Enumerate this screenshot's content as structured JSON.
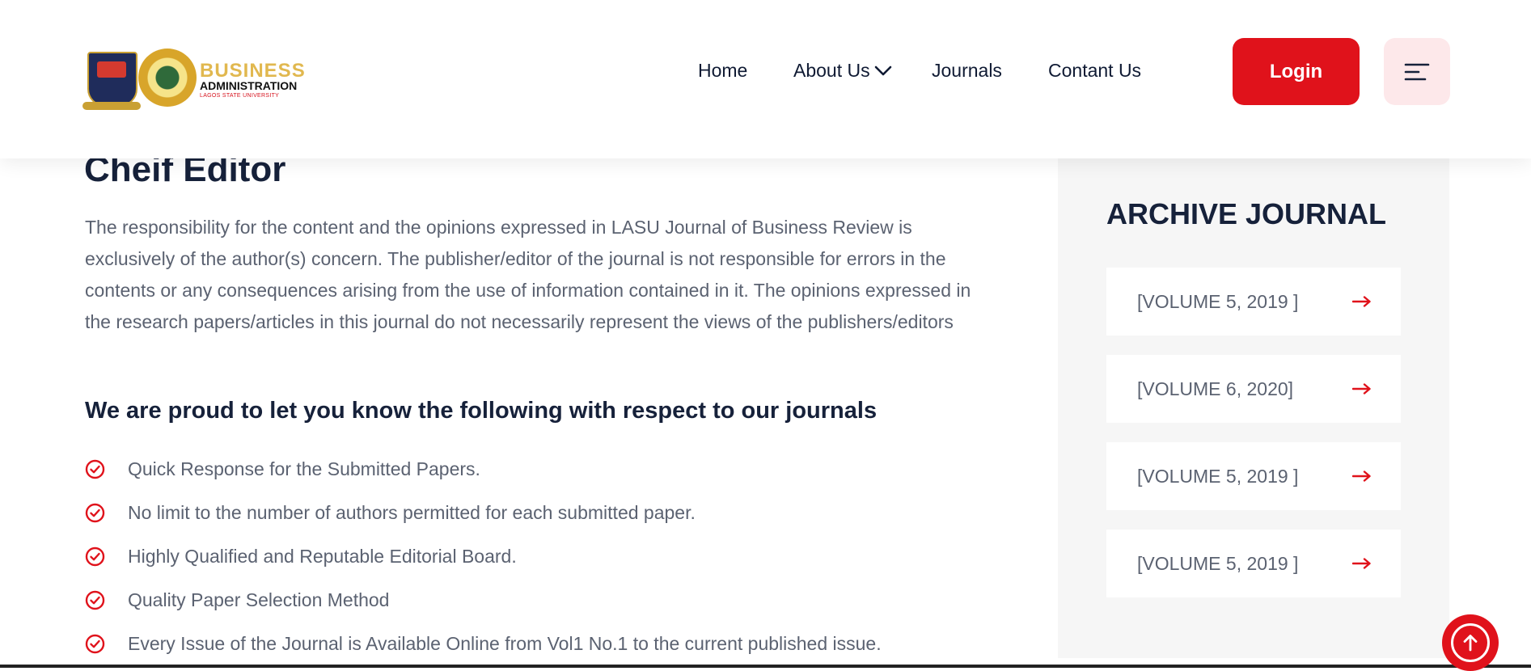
{
  "header": {
    "logo": {
      "line1": "BUSINESS",
      "line2": "ADMINISTRATION",
      "line3": "LAGOS STATE UNIVERSITY"
    },
    "nav": [
      {
        "label": "Home"
      },
      {
        "label": "About Us"
      },
      {
        "label": "Journals"
      },
      {
        "label": "Contant Us"
      }
    ],
    "login_label": "Login",
    "menu_icon": "hamburger-icon"
  },
  "main": {
    "heading": "Cheif Editor",
    "paragraph": "The responsibility for the content and the opinions expressed in LASU Journal of Business Review is exclusively of the author(s) concern. The publisher/editor of the journal is not responsible for errors in the contents or any consequences arising from the use of information contained in it. The opinions expressed in the research papers/articles in this journal do not necessarily represent the views of the publishers/editors",
    "subheading": "We are proud to let you know the following with respect to our journals",
    "features": [
      "Quick Response for the Submitted Papers.",
      "No limit to the number of authors permitted for each submitted paper.",
      "Highly Qualified and Reputable Editorial Board.",
      "Quality Paper Selection Method",
      "Every Issue of the Journal is Available Online from Vol1 No.1 to the current published issue."
    ]
  },
  "sidebar": {
    "title": "ARCHIVE JOURNAL",
    "volumes": [
      "[VOLUME 5, 2019 ]",
      "[VOLUME 6, 2020]",
      "[VOLUME 5, 2019 ]",
      "[VOLUME 5, 2019 ]"
    ]
  },
  "colors": {
    "accent": "#e0121b",
    "heading": "#16213a",
    "body_text": "#5b6271",
    "sidebar_bg": "#f6f6f6",
    "logo_gold": "#e1b84f"
  }
}
